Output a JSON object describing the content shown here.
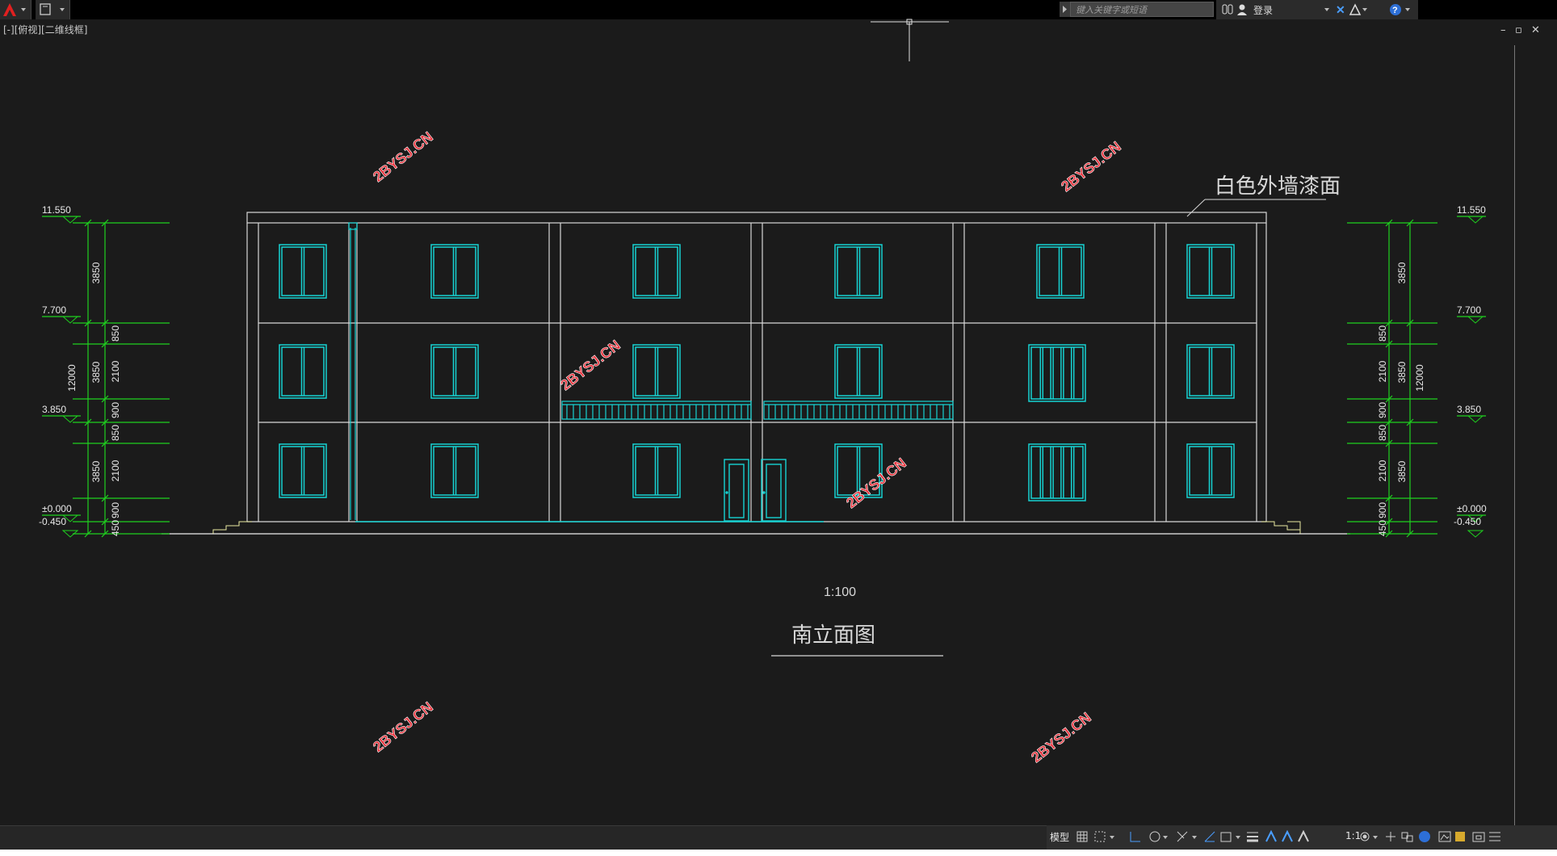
{
  "toolbar": {
    "search_placeholder": "键入关键字或短语",
    "login_label": "登录"
  },
  "viewport": {
    "label": "[-][俯视][二维线框]"
  },
  "window_controls": {
    "minimize": "–",
    "restore": "▫",
    "close": "✕"
  },
  "drawing": {
    "title": "南立面图",
    "scale": "1:100",
    "material_note": "白色外墙漆面",
    "watermark": "2BYSJ.CN",
    "elevations_left": [
      "11.550",
      "7.700",
      "3.850",
      "±0.000",
      "-0.450"
    ],
    "elevations_right": [
      "11.550",
      "7.700",
      "3.850",
      "±0.000",
      "-0.450"
    ],
    "dims_total": "12000",
    "dims_floor": [
      "3850",
      "3850",
      "3850"
    ],
    "dims_detail": [
      "850",
      "2100",
      "900",
      "850",
      "2100",
      "900",
      "450"
    ]
  },
  "statusbar": {
    "model_label": "模型",
    "annotation_scale": "1:1"
  },
  "colors": {
    "background": "#1b1b1b",
    "linework": "#d8d8d8",
    "windows": "#16d3d3",
    "dimensions": "#1fd11f",
    "watermark": "#e8303a",
    "ground": "#e8e8a0"
  }
}
